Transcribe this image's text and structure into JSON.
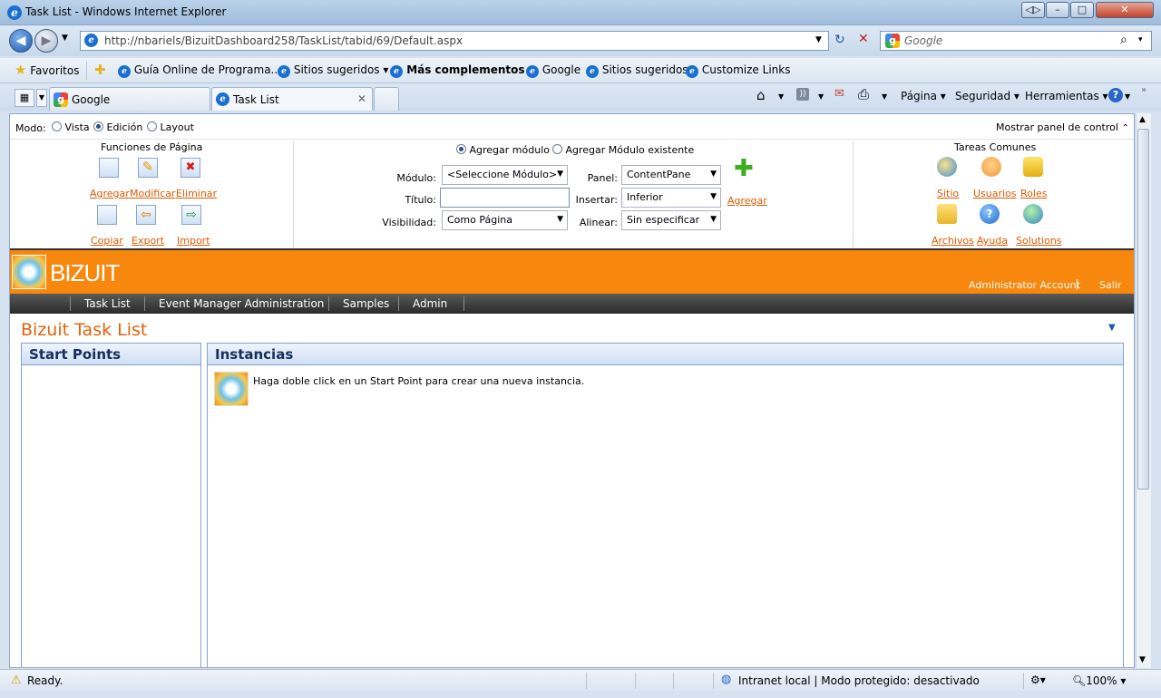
{
  "window": {
    "title": "Task List - Windows Internet Explorer",
    "minimize": "–",
    "maximize": "□",
    "close": "✕"
  },
  "address": {
    "url": "http://nbariels/BizuitDashboard258/TaskList/tabid/69/Default.aspx",
    "search_placeholder": "Google"
  },
  "favorites": {
    "label": "Favoritos",
    "items": [
      "Guía Online de Programa...",
      "Sitios sugeridos ▾",
      "Más complementos ▾",
      "Google",
      "Sitios sugeridos",
      "Customize Links"
    ]
  },
  "tabs": [
    {
      "label": "Google"
    },
    {
      "label": "Task List"
    }
  ],
  "toolbar": {
    "pagina": "Página ▾",
    "seguridad": "Seguridad ▾",
    "herramientas": "Herramientas ▾"
  },
  "control_panel": {
    "mode_label": "Modo:",
    "modes": [
      "Vista",
      "Edición",
      "Layout"
    ],
    "selected_mode": "Edición",
    "show_panel": "Mostrar panel de control",
    "page_functions": {
      "title": "Funciones de Página",
      "actions": [
        "Agregar",
        "Modificar",
        "Eliminar",
        "Copiar",
        "Export",
        "Import"
      ]
    },
    "module": {
      "add_new": "Agregar módulo",
      "add_existing": "Agregar Módulo existente",
      "modulo_label": "Módulo:",
      "modulo_value": "<Seleccione Módulo>",
      "titulo_label": "Título:",
      "visibilidad_label": "Visibilidad:",
      "visibilidad_value": "Como Página",
      "panel_label": "Panel:",
      "panel_value": "ContentPane",
      "insertar_label": "Insertar:",
      "insertar_value": "Inferior",
      "alinear_label": "Alinear:",
      "alinear_value": "Sin especificar",
      "add_link": "Agregar"
    },
    "common_tasks": {
      "title": "Tareas Comunes",
      "actions": [
        "Sitio",
        "Usuarios",
        "Roles",
        "Archivos",
        "Ayuda",
        "Solutions"
      ]
    }
  },
  "banner": {
    "logo": "BIZUIT",
    "account": "Administrator Account",
    "logout": "Salir"
  },
  "nav": [
    "Task List",
    "Event Manager Administration",
    "Samples",
    "Admin"
  ],
  "content": {
    "page_title": "Bizuit Task List",
    "start_points_title": "Start Points",
    "instancias_title": "Instancias",
    "instancias_hint": "Haga doble click en un Start Point para crear una nueva instancia."
  },
  "status": {
    "ready": "Ready.",
    "zone": "Intranet local | Modo protegido: desactivado",
    "zoom": "100%"
  },
  "colors": {
    "brand_orange": "#f7870d",
    "link_orange": "#e05a00",
    "title_orange": "#e0620a"
  }
}
